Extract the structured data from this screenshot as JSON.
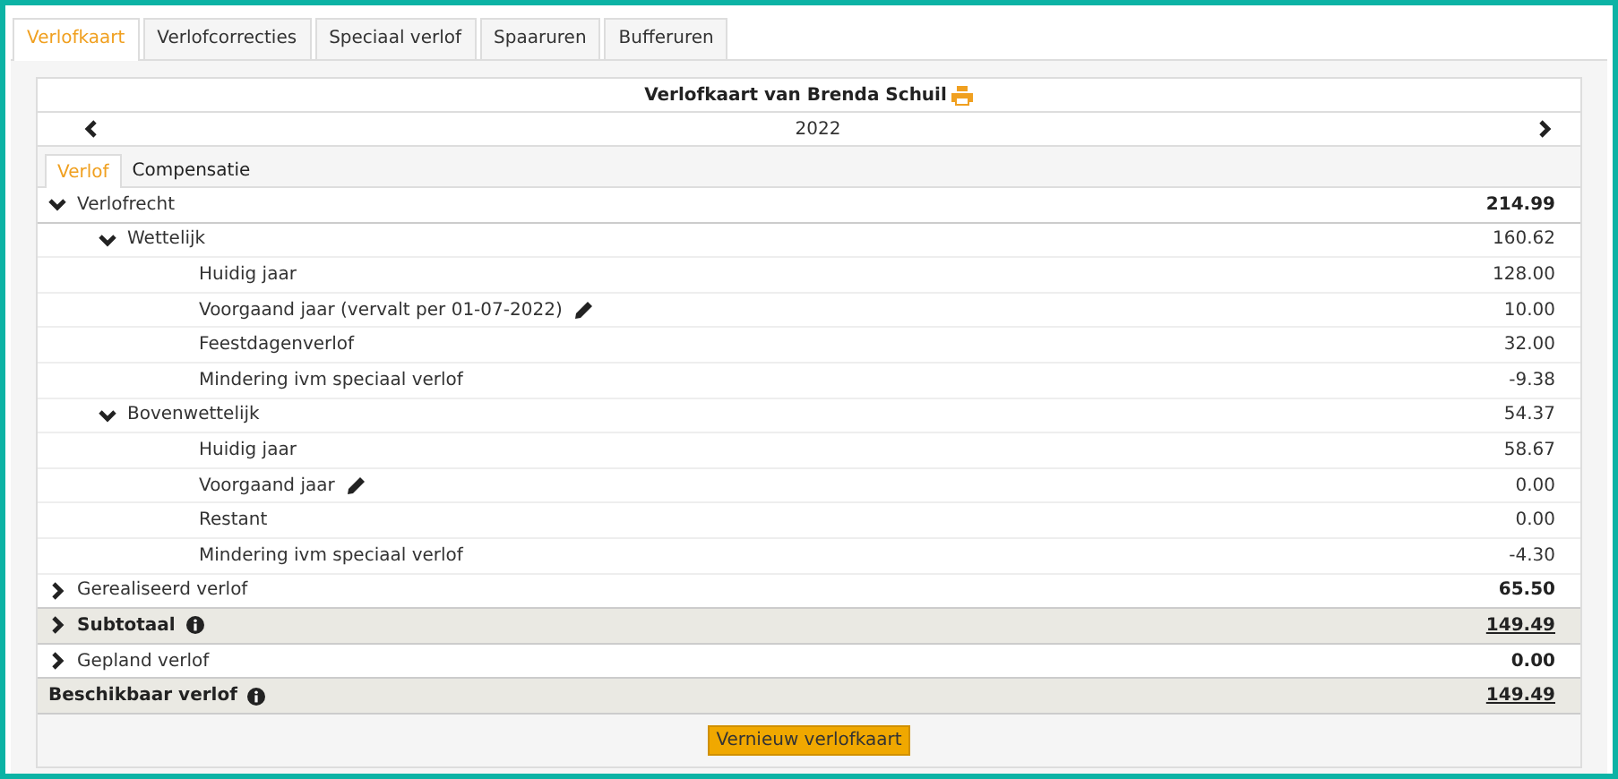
{
  "tabs": [
    {
      "label": "Verlofkaart",
      "selected": true
    },
    {
      "label": "Verlofcorrecties",
      "selected": false
    },
    {
      "label": "Speciaal verlof",
      "selected": false
    },
    {
      "label": "Spaaruren",
      "selected": false
    },
    {
      "label": "Bufferuren",
      "selected": false
    }
  ],
  "card": {
    "title": "Verlofkaart van Brenda Schuil",
    "year": "2022",
    "subtabs": [
      {
        "label": "Verlof",
        "selected": true
      },
      {
        "label": "Compensatie",
        "selected": false
      }
    ],
    "rows": [
      {
        "kind": "group",
        "label": "Verlofrecht",
        "value": "214.99",
        "expanded": true,
        "children": [
          {
            "kind": "group",
            "label": "Wettelijk",
            "value": "160.62",
            "expanded": true,
            "children": [
              {
                "kind": "item",
                "label": "Huidig jaar",
                "value": "128.00"
              },
              {
                "kind": "item",
                "label": "Voorgaand jaar (vervalt per 01-07-2022)",
                "value": "10.00",
                "editable": true
              },
              {
                "kind": "item",
                "label": "Feestdagenverlof",
                "value": "32.00"
              },
              {
                "kind": "item",
                "label": "Mindering ivm speciaal verlof",
                "value": "-9.38"
              }
            ]
          },
          {
            "kind": "group",
            "label": "Bovenwettelijk",
            "value": "54.37",
            "expanded": true,
            "children": [
              {
                "kind": "item",
                "label": "Huidig jaar",
                "value": "58.67"
              },
              {
                "kind": "item",
                "label": "Voorgaand jaar",
                "value": "0.00",
                "editable": true
              },
              {
                "kind": "item",
                "label": "Restant",
                "value": "0.00"
              },
              {
                "kind": "item",
                "label": "Mindering ivm speciaal verlof",
                "value": "-4.30"
              }
            ]
          }
        ]
      },
      {
        "kind": "group",
        "label": "Gerealiseerd verlof",
        "value": "65.50",
        "expanded": false
      },
      {
        "kind": "total",
        "label": "Subtotaal",
        "value": "149.49",
        "expanded": false,
        "info": true
      },
      {
        "kind": "group",
        "label": "Gepland verlof",
        "value": "0.00",
        "expanded": false
      },
      {
        "kind": "total",
        "label": "Beschikbaar verlof",
        "value": "149.49",
        "info": true
      }
    ]
  },
  "button": "Vernieuw verlofkaart"
}
